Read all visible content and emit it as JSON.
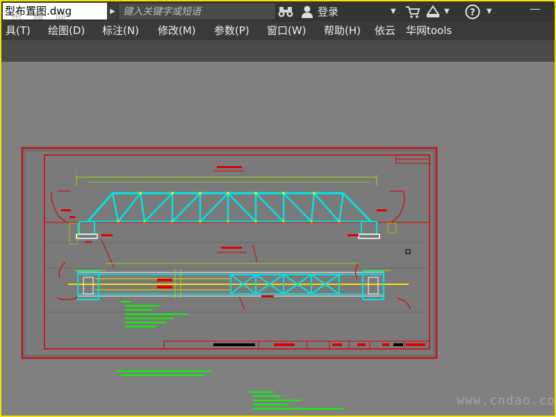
{
  "titlebar": {
    "doc_title": "型布置图.dwg",
    "watermark": "迅 稿 网",
    "search_placeholder": "键入关键字或短语",
    "login_label": "登录"
  },
  "menubar": {
    "items": [
      {
        "label": "具(T)"
      },
      {
        "label": "绘图(D)"
      },
      {
        "label": "标注(N)"
      },
      {
        "label": "修改(M)"
      },
      {
        "label": "参数(P)"
      },
      {
        "label": "窗口(W)"
      },
      {
        "label": "帮助(H)"
      },
      {
        "label": "依云"
      },
      {
        "label": "华网tools"
      }
    ]
  },
  "drawing": {
    "watermark": "www.cndao.com"
  },
  "colors": {
    "titlebar_bg": "#343434",
    "menubar_bg": "#3a3a3a",
    "ribbon_bg": "#4b4b4b",
    "canvas_bg": "#808080",
    "sheet_bg": "#7a7a7a",
    "truss": "#00e5e5",
    "border_red": "#e00000",
    "annotation_green": "#00ff00",
    "highlight_yellow": "#f5e200"
  },
  "icons": [
    "binoculars-icon",
    "user-icon",
    "cart-icon",
    "exchange-icon",
    "help-icon",
    "chevron-down-icon"
  ]
}
